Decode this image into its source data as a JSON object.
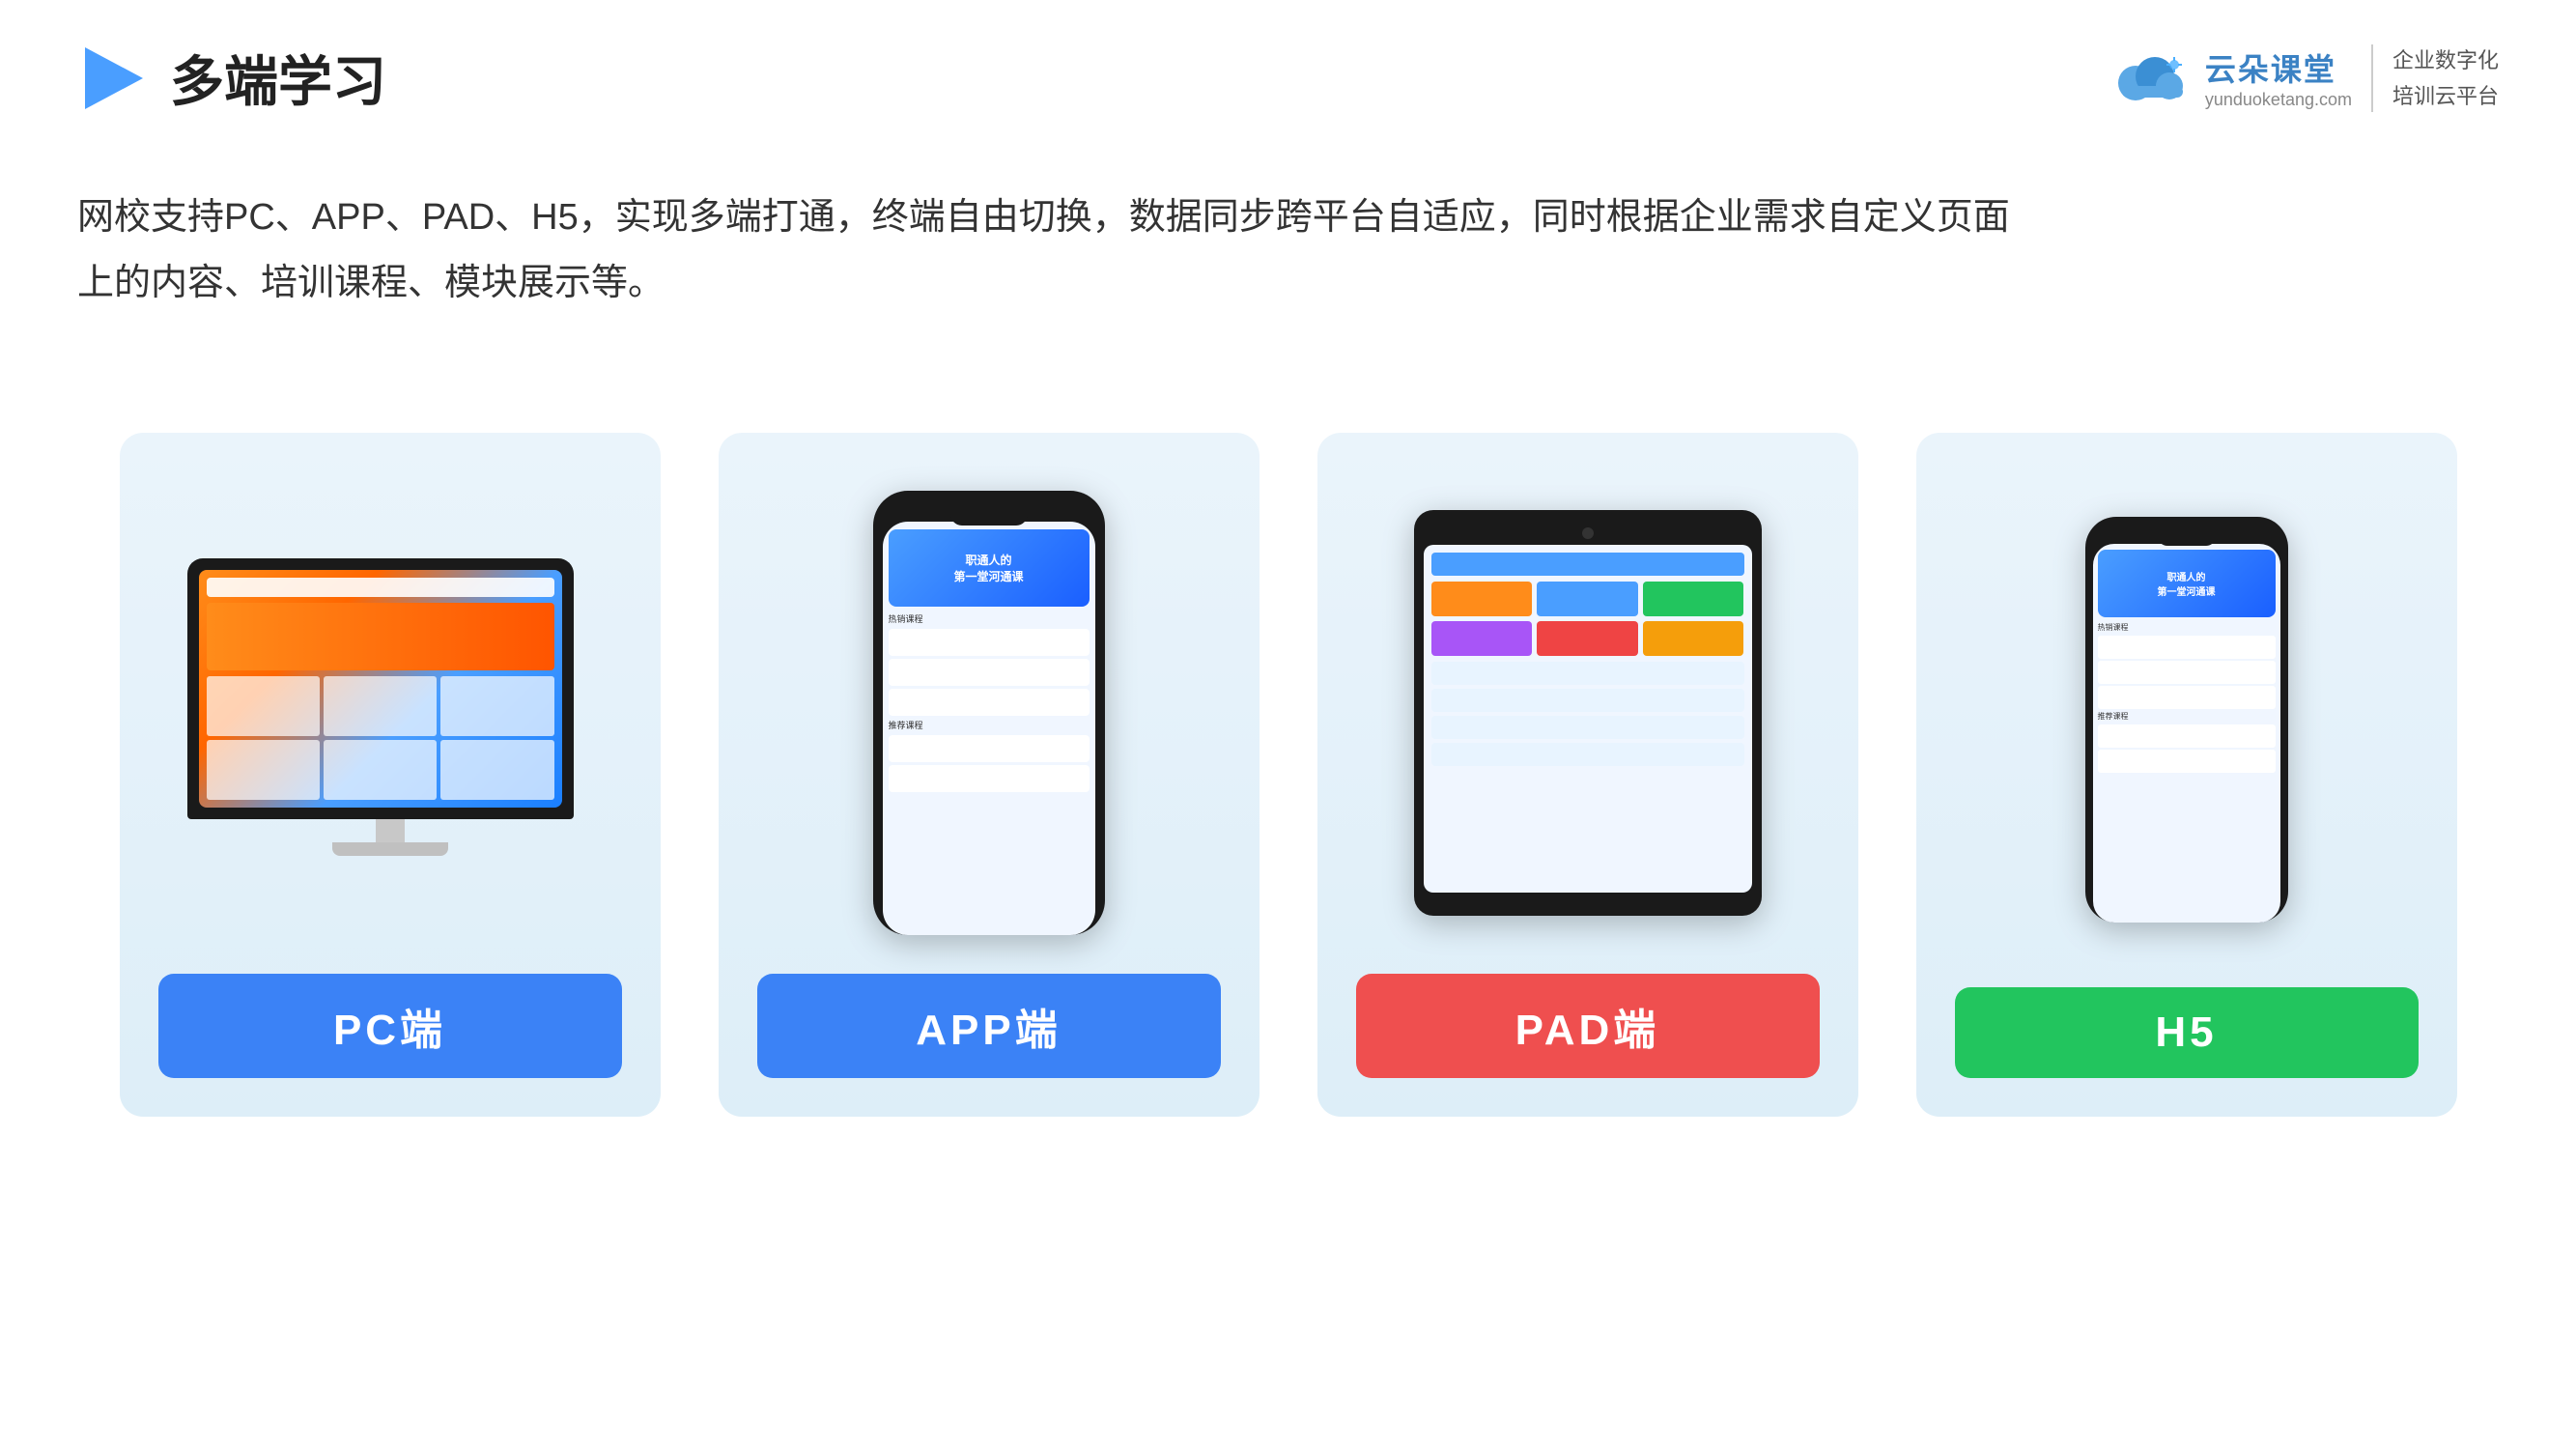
{
  "header": {
    "title": "多端学习",
    "brand": {
      "name": "云朵课堂",
      "url": "yunduoketang.com",
      "slogan_line1": "企业数字化",
      "slogan_line2": "培训云平台"
    }
  },
  "description": {
    "line1": "网校支持PC、APP、PAD、H5，实现多端打通，终端自由切换，数据同步跨平台自适应，同时根据企业需求自定义页面",
    "line2": "上的内容、培训课程、模块展示等。"
  },
  "cards": [
    {
      "id": "pc",
      "label": "PC端",
      "label_color": "label-blue",
      "device": "pc"
    },
    {
      "id": "app",
      "label": "APP端",
      "label_color": "label-blue",
      "device": "phone"
    },
    {
      "id": "pad",
      "label": "PAD端",
      "label_color": "label-orange",
      "device": "tablet"
    },
    {
      "id": "h5",
      "label": "H5",
      "label_color": "label-green",
      "device": "phone-small"
    }
  ],
  "colors": {
    "accent_blue": "#3b82f6",
    "accent_red": "#ef4f4f",
    "accent_green": "#22c55e",
    "card_bg_start": "#eaf4fb",
    "card_bg_end": "#ddeef8"
  }
}
